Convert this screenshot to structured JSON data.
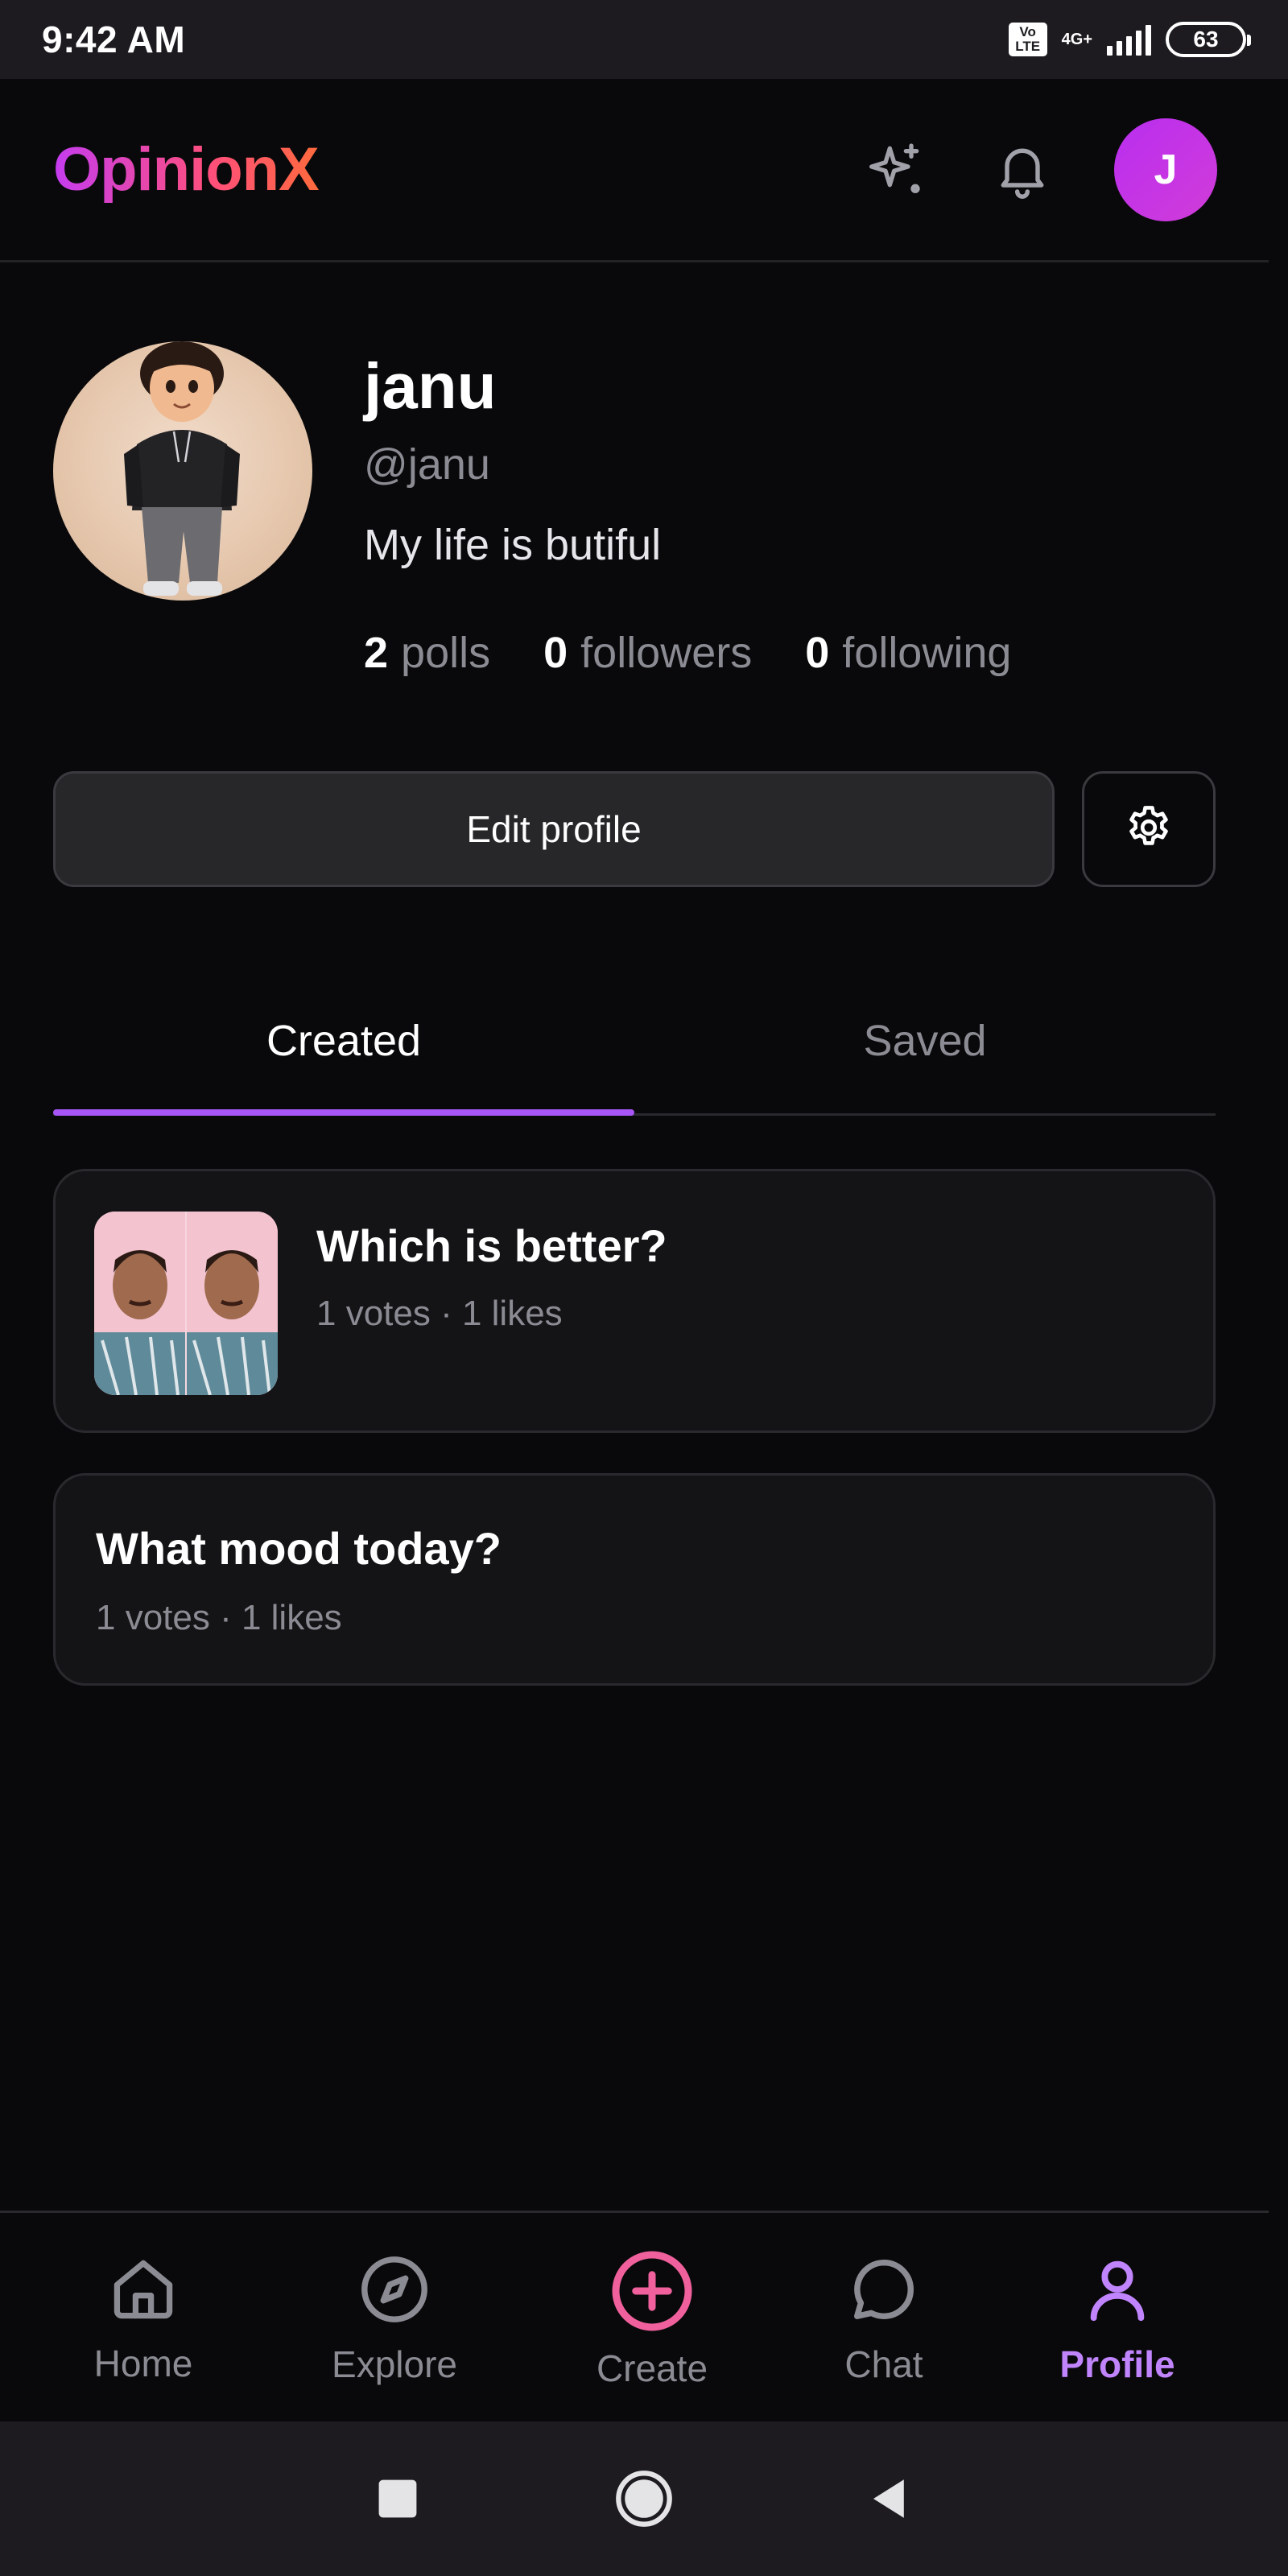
{
  "status_bar": {
    "time": "9:42 AM",
    "volte": "Vo LTE",
    "network": "4G+",
    "battery": "63"
  },
  "header": {
    "brand": "OpinionX",
    "avatar_initial": "J",
    "icons": [
      "sparkle-icon",
      "bell-icon"
    ]
  },
  "profile": {
    "name": "janu",
    "handle": "@janu",
    "bio": "My life is butiful",
    "stats": [
      {
        "value": "2",
        "label": "polls"
      },
      {
        "value": "0",
        "label": "followers"
      },
      {
        "value": "0",
        "label": "following"
      }
    ],
    "edit_label": "Edit profile"
  },
  "tabs": {
    "created": "Created",
    "saved": "Saved",
    "active": "Created"
  },
  "polls": [
    {
      "title": "Which is better?",
      "meta": "1 votes · 1 likes",
      "has_image": true
    },
    {
      "title": "What mood today?",
      "meta": "1 votes · 1 likes",
      "has_image": false
    }
  ],
  "bottom_nav": {
    "items": [
      {
        "label": "Home",
        "icon": "home-icon"
      },
      {
        "label": "Explore",
        "icon": "compass-icon"
      },
      {
        "label": "Create",
        "icon": "plus-circle-icon"
      },
      {
        "label": "Chat",
        "icon": "chat-bubble-icon"
      },
      {
        "label": "Profile",
        "icon": "user-icon"
      }
    ],
    "active": "Profile"
  },
  "colors": {
    "background": "#09090b",
    "accent": "#a855f7",
    "active_nav": "#c084fc",
    "create": "#f0609c"
  }
}
